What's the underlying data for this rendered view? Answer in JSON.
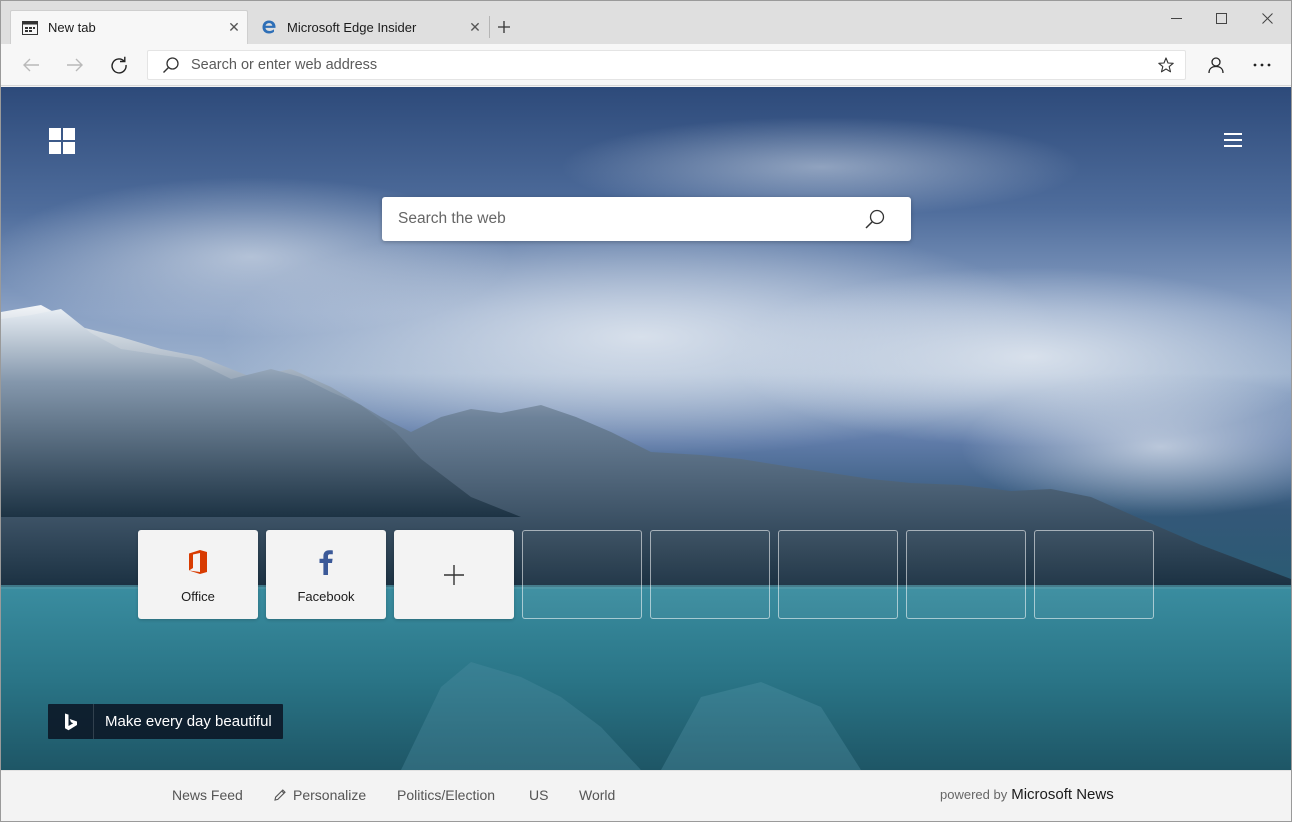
{
  "tabs": [
    {
      "title": "New tab",
      "icon": "newtab-page-icon",
      "active": true
    },
    {
      "title": "Microsoft Edge Insider",
      "icon": "edge-logo-icon",
      "active": false
    }
  ],
  "toolbar": {
    "address_placeholder": "Search or enter web address"
  },
  "ntp": {
    "search_placeholder": "Search the web",
    "tiles": [
      {
        "label": "Office",
        "icon": "office-icon",
        "color": "#d83b01"
      },
      {
        "label": "Facebook",
        "icon": "facebook-icon",
        "color": "#3b5998"
      }
    ],
    "empty_tile_count": 5,
    "bing_caption": "Make every day beautiful"
  },
  "news": {
    "items": [
      "News Feed",
      "Personalize",
      "Politics/Election",
      "US",
      "World"
    ],
    "powered_prefix": "powered by",
    "powered_brand": "Microsoft News"
  }
}
